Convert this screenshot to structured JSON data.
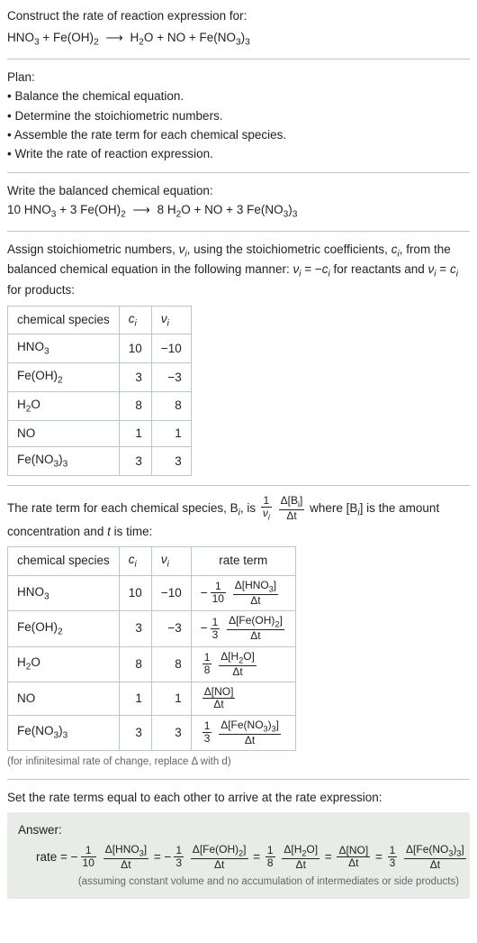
{
  "intro": {
    "prompt": "Construct the rate of reaction expression for:",
    "eq_lhs1": "HNO",
    "eq_lhs1_sub": "3",
    "eq_lhs2": "Fe(OH)",
    "eq_lhs2_sub": "2",
    "eq_rhs1": "H",
    "eq_rhs1_sub": "2",
    "eq_rhs1b": "O",
    "eq_rhs2": "NO",
    "eq_rhs3": "Fe(NO",
    "eq_rhs3_sub": "3",
    "eq_rhs3b": ")",
    "eq_rhs3_sub2": "3",
    "plus": " + ",
    "arrow": "⟶"
  },
  "plan": {
    "title": "Plan:",
    "b1": "• Balance the chemical equation.",
    "b2": "• Determine the stoichiometric numbers.",
    "b3": "• Assemble the rate term for each chemical species.",
    "b4": "• Write the rate of reaction expression."
  },
  "balanced": {
    "title": "Write the balanced chemical equation:",
    "c1": "10 ",
    "s1": "HNO",
    "s1s": "3",
    "c2": "3 ",
    "s2": "Fe(OH)",
    "s2s": "2",
    "c3": "8 ",
    "s3": "H",
    "s3s": "2",
    "s3b": "O",
    "c4": "",
    "s4": "NO",
    "c5": "3 ",
    "s5": "Fe(NO",
    "s5s": "3",
    "s5b": ")",
    "s5s2": "3"
  },
  "assign": {
    "text_a": "Assign stoichiometric numbers, ",
    "nu_i": "ν",
    "text_b": ", using the stoichiometric coefficients, ",
    "c_i": "c",
    "text_c": ", from the balanced chemical equation in the following manner: ",
    "rel_react": " = −",
    "rel_react_b": " for reactants and ",
    "rel_prod": " = ",
    "rel_prod_b": " for products:"
  },
  "table1": {
    "h1": "chemical species",
    "h2": "c",
    "h2_sub": "i",
    "h3": "ν",
    "h3_sub": "i",
    "rows": [
      {
        "sp": "HNO",
        "sp_s": "3",
        "c": "10",
        "v": "−10"
      },
      {
        "sp": "Fe(OH)",
        "sp_s": "2",
        "c": "3",
        "v": "−3"
      },
      {
        "sp": "H",
        "sp_s": "2",
        "sp_b": "O",
        "c": "8",
        "v": "8"
      },
      {
        "sp": "NO",
        "sp_s": "",
        "c": "1",
        "v": "1"
      },
      {
        "sp": "Fe(NO",
        "sp_s": "3",
        "sp_b": ")",
        "sp_s2": "3",
        "c": "3",
        "v": "3"
      }
    ]
  },
  "rateterm": {
    "text_a": "The rate term for each chemical species, B",
    "text_b": ", is ",
    "frac1_num": "1",
    "frac1_den": "ν",
    "frac2_num": "Δ[B",
    "frac2_num_sub": "i",
    "frac2_num_b": "]",
    "frac2_den": "Δt",
    "text_c": " where [B",
    "text_d": "] is the amount concentration and ",
    "text_e": " is time:",
    "t": "t"
  },
  "table2": {
    "h1": "chemical species",
    "h2": "c",
    "h2_sub": "i",
    "h3": "ν",
    "h3_sub": "i",
    "h4": "rate term",
    "rows": [
      {
        "sp": "HNO",
        "sp_s": "3",
        "c": "10",
        "v": "−10",
        "neg": "−",
        "coef_num": "1",
        "coef_den": "10",
        "d_num": "Δ[HNO",
        "d_num_s": "3",
        "d_num_b": "]",
        "d_den": "Δt"
      },
      {
        "sp": "Fe(OH)",
        "sp_s": "2",
        "c": "3",
        "v": "−3",
        "neg": "−",
        "coef_num": "1",
        "coef_den": "3",
        "d_num": "Δ[Fe(OH)",
        "d_num_s": "2",
        "d_num_b": "]",
        "d_den": "Δt"
      },
      {
        "sp": "H",
        "sp_s": "2",
        "sp_b": "O",
        "c": "8",
        "v": "8",
        "neg": "",
        "coef_num": "1",
        "coef_den": "8",
        "d_num": "Δ[H",
        "d_num_s": "2",
        "d_num_b": "O]",
        "d_den": "Δt"
      },
      {
        "sp": "NO",
        "sp_s": "",
        "c": "1",
        "v": "1",
        "neg": "",
        "coef_num": "",
        "coef_den": "",
        "d_num": "Δ[NO]",
        "d_num_s": "",
        "d_num_b": "",
        "d_den": "Δt"
      },
      {
        "sp": "Fe(NO",
        "sp_s": "3",
        "sp_b": ")",
        "sp_s2": "3",
        "c": "3",
        "v": "3",
        "neg": "",
        "coef_num": "1",
        "coef_den": "3",
        "d_num": "Δ[Fe(NO",
        "d_num_s": "3",
        "d_num_b": ")",
        "d_num_s2": "3",
        "d_num_c": "]",
        "d_den": "Δt"
      }
    ]
  },
  "footnote": "(for infinitesimal rate of change, replace Δ with d)",
  "final": {
    "title": "Set the rate terms equal to each other to arrive at the rate expression:"
  },
  "answer": {
    "label": "Answer:",
    "rate_eq": "rate = ",
    "eq": " = ",
    "terms": [
      {
        "neg": "−",
        "cn": "1",
        "cd": "10",
        "dn": "Δ[HNO",
        "dns": "3",
        "dnb": "]",
        "dd": "Δt"
      },
      {
        "neg": "−",
        "cn": "1",
        "cd": "3",
        "dn": "Δ[Fe(OH)",
        "dns": "2",
        "dnb": "]",
        "dd": "Δt"
      },
      {
        "neg": "",
        "cn": "1",
        "cd": "8",
        "dn": "Δ[H",
        "dns": "2",
        "dnb": "O]",
        "dd": "Δt"
      },
      {
        "neg": "",
        "cn": "",
        "cd": "",
        "dn": "Δ[NO]",
        "dns": "",
        "dnb": "",
        "dd": "Δt"
      },
      {
        "neg": "",
        "cn": "1",
        "cd": "3",
        "dn": "Δ[Fe(NO",
        "dns": "3",
        "dnb": ")",
        "dns2": "3",
        "dnc": "]",
        "dd": "Δt"
      }
    ],
    "footnote": "(assuming constant volume and no accumulation of intermediates or side products)"
  }
}
